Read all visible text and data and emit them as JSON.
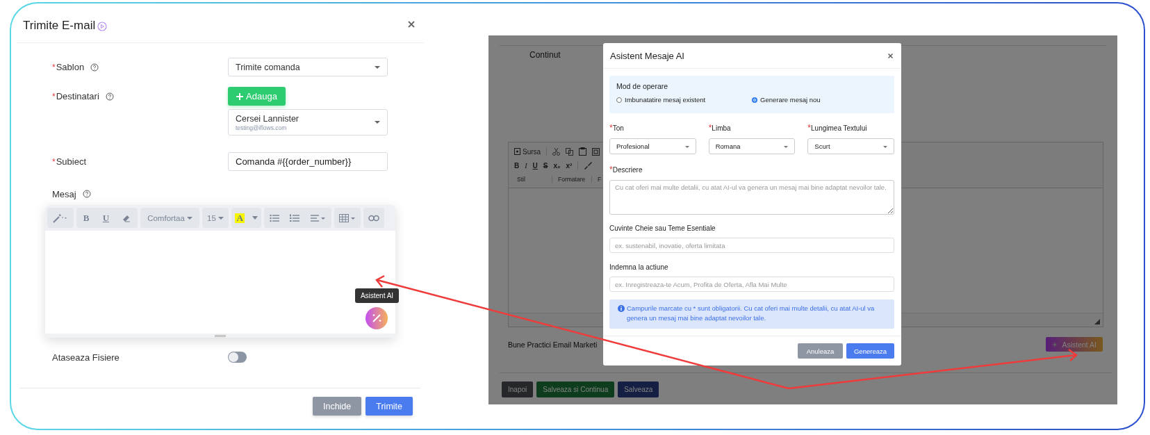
{
  "dialog": {
    "title": "Trimite E-mail",
    "fields": [
      {
        "kind": "select",
        "label": "Sablon",
        "required_mark": "*",
        "help": true,
        "value": "Trimite comanda"
      },
      {
        "kind": "recipients",
        "label": "Destinatari",
        "required_mark": "*",
        "help": true,
        "add_label": "Adauga",
        "name": "Cersei Lannister",
        "email": "testing@iflows.com"
      },
      {
        "kind": "text",
        "label": "Subiect",
        "required_mark": "*",
        "help": false,
        "value": "Comanda #{{order_number}}"
      },
      {
        "kind": "editor",
        "label": "Mesaj",
        "help": true,
        "toolbar": {
          "bold": "B",
          "underline": "U",
          "font": "Comfortaa",
          "size": "15",
          "highlight": "A"
        },
        "tooltip": "Asistent AI"
      },
      {
        "kind": "toggle",
        "label": "Ataseaza Fisiere",
        "help": false,
        "on": false
      }
    ],
    "buttons": [
      {
        "label": "Inchide",
        "kind": "secondary"
      },
      {
        "label": "Trimite",
        "kind": "primary"
      }
    ]
  },
  "background_page": {
    "content_label": "Continut",
    "toolbar": {
      "source": "Sursa",
      "bold": "B",
      "italic": "I",
      "underline": "U",
      "strike": "S",
      "subscript": "x₂",
      "superscript": "x²",
      "style": "Stil",
      "format": "Formatare",
      "font": "F"
    },
    "practices_label": "Bune Practici Email Marketi",
    "ai_button": "Asistent AI",
    "buttons": [
      {
        "label": "Inapoi",
        "kind": "secondary"
      },
      {
        "label": "Salveaza si Continua",
        "kind": "success"
      },
      {
        "label": "Salveaza",
        "kind": "primary"
      }
    ]
  },
  "modal": {
    "title": "Asistent Mesaje AI",
    "mode": {
      "label": "Mod de operare",
      "options": [
        {
          "label": "Imbunatatire mesaj existent",
          "selected": false
        },
        {
          "label": "Generare mesaj nou",
          "selected": true
        }
      ]
    },
    "selects": [
      {
        "label": "Ton",
        "required_mark": "*",
        "value": "Profesional"
      },
      {
        "label": "Limba",
        "required_mark": "*",
        "value": "Romana"
      },
      {
        "label": "Lungimea Textului",
        "required_mark": "*",
        "value": "Scurt"
      }
    ],
    "description": {
      "label": "Descriere",
      "required_mark": "*",
      "placeholder": "Cu cat oferi mai multe detalii, cu atat AI-ul va genera un mesaj mai bine adaptat nevoilor tale."
    },
    "keywords": {
      "label": "Cuvinte Cheie sau Teme Esentiale",
      "placeholder": "ex. sustenabil, inovatie, oferta limitata"
    },
    "cta": {
      "label": "Indemna la actiune",
      "placeholder": "ex. Inregistreaza-te Acum, Profita de Oferta, Afla Mai Multe"
    },
    "info": "Campurile marcate cu * sunt obligatorii. Cu cat oferi mai multe detalii, cu atat AI-ul va genera un mesaj mai bine adaptat nevoilor tale.",
    "buttons": [
      {
        "label": "Anuleaza",
        "kind": "secondary"
      },
      {
        "label": "Genereaza",
        "kind": "primary"
      }
    ]
  }
}
